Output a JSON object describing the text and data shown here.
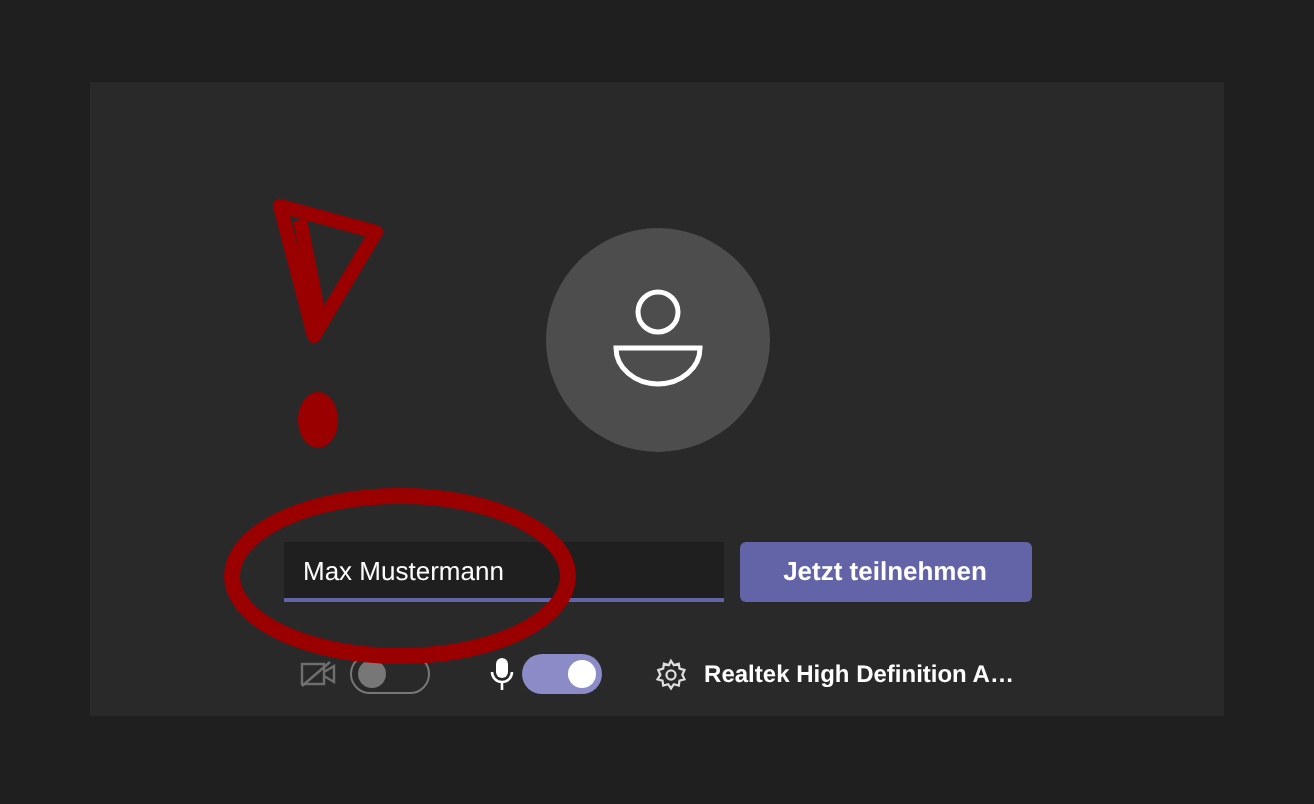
{
  "name_field": {
    "value": "Max Mustermann"
  },
  "join_button": {
    "label": "Jetzt teilnehmen"
  },
  "camera": {
    "on": false
  },
  "microphone": {
    "on": true
  },
  "audio_device": {
    "label": "Realtek High Definition A…"
  }
}
